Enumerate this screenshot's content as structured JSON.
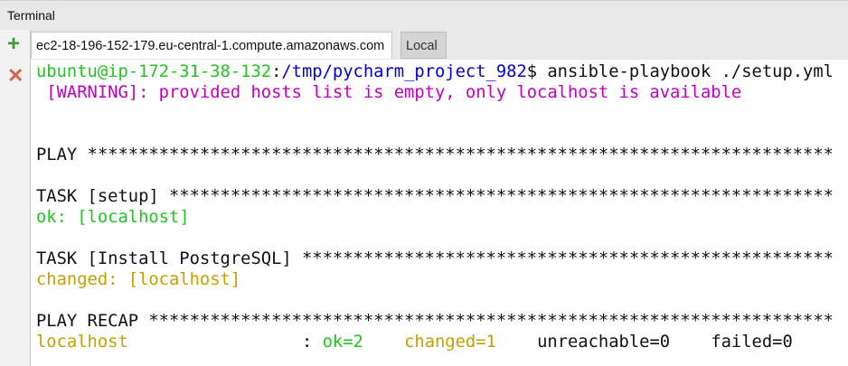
{
  "window": {
    "title": "Terminal"
  },
  "sidebar": {
    "new_session_icon": "+",
    "close_session_icon": "✕"
  },
  "tabs": [
    {
      "label": "ec2-18-196-152-179.eu-central-1.compute.amazonaws.com"
    },
    {
      "label": "Local"
    }
  ],
  "terminal": {
    "prompt_user": "ubuntu@ip-172-31-38-132",
    "prompt_sep": ":",
    "prompt_path": "/tmp/pycharm_project_982",
    "prompt_command": "$ ansible-playbook ./setup.yml",
    "warning": " [WARNING]: provided hosts list is empty, only localhost is available",
    "play": "PLAY *************************************************************************",
    "task_setup": "TASK [setup] *****************************************************************",
    "task_setup_result": "ok: [localhost]",
    "task_install": "TASK [Install PostgreSQL] ****************************************************",
    "task_install_result": "changed: [localhost]",
    "recap": "PLAY RECAP *******************************************************************",
    "recap_host": "localhost",
    "recap_colon": "                 : ",
    "recap_ok": "ok=2",
    "recap_changed": "changed=1",
    "recap_unreachable": "unreachable=0",
    "recap_failed": "failed=0"
  },
  "colors": {
    "green": "#22c322",
    "blue": "#0000d0",
    "magenta": "#c000c0",
    "yellow": "#c4a000"
  }
}
